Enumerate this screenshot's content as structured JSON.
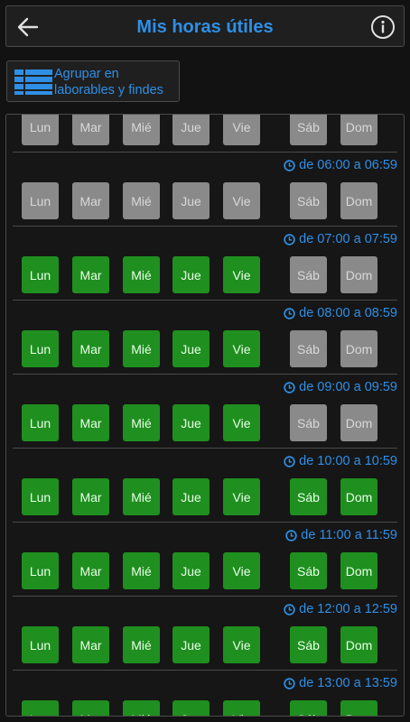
{
  "header": {
    "title": "Mis horas útiles",
    "back_icon": "arrow-left-icon",
    "info_icon": "info-icon"
  },
  "group_button": {
    "label_line1": "Agrupar en",
    "label_line2": "laborables y findes",
    "icon": "grid-icon"
  },
  "day_labels": [
    "Lun",
    "Mar",
    "Mié",
    "Jue",
    "Vie",
    "Sáb",
    "Dom"
  ],
  "colors": {
    "accent": "#2f8fe6",
    "on": "#1f8f1f",
    "off": "#8a8a8a"
  },
  "rows": [
    {
      "time": "",
      "weekdays_on": false,
      "weekend_on": false
    },
    {
      "time": "de 06:00 a 06:59",
      "weekdays_on": false,
      "weekend_on": false
    },
    {
      "time": "de 07:00 a 07:59",
      "weekdays_on": true,
      "weekend_on": false
    },
    {
      "time": "de 08:00 a 08:59",
      "weekdays_on": true,
      "weekend_on": false
    },
    {
      "time": "de 09:00 a 09:59",
      "weekdays_on": true,
      "weekend_on": false
    },
    {
      "time": "de 10:00 a 10:59",
      "weekdays_on": true,
      "weekend_on": true
    },
    {
      "time": "de 11:00 a 11:59",
      "weekdays_on": true,
      "weekend_on": true
    },
    {
      "time": "de 12:00 a 12:59",
      "weekdays_on": true,
      "weekend_on": true
    },
    {
      "time": "de 13:00 a 13:59",
      "weekdays_on": true,
      "weekend_on": true
    }
  ]
}
